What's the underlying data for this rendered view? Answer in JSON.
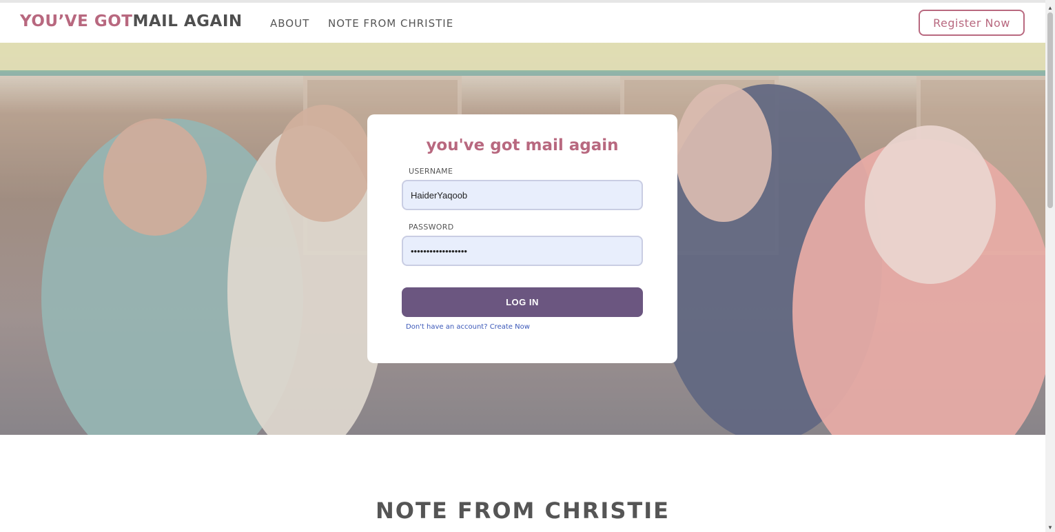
{
  "navbar": {
    "brand_part1": "YOU’VE GOT",
    "brand_part2": "MAIL AGAIN",
    "links": [
      "ABOUT",
      "NOTE FROM CHRISTIE"
    ],
    "register_label": "Register Now"
  },
  "login": {
    "title": "you've got mail again",
    "username_label": "USERNAME",
    "username_value": "HaiderYaqoob",
    "password_label": "PASSWORD",
    "password_value": "••••••••••••••••••",
    "login_label": "LOG IN",
    "signup_prompt": "Don't have an account?",
    "signup_link": "Create Now"
  },
  "section": {
    "title": "NOTE FROM CHRISTIE"
  },
  "colors": {
    "brand_pink": "#b8687f",
    "brand_gray": "#4f4f4f",
    "button_purple": "#6b5680",
    "link_blue": "#3a57b8",
    "input_bg": "#e8eefc"
  },
  "icons": {
    "scroll_up": "▲",
    "scroll_down": "▼"
  }
}
